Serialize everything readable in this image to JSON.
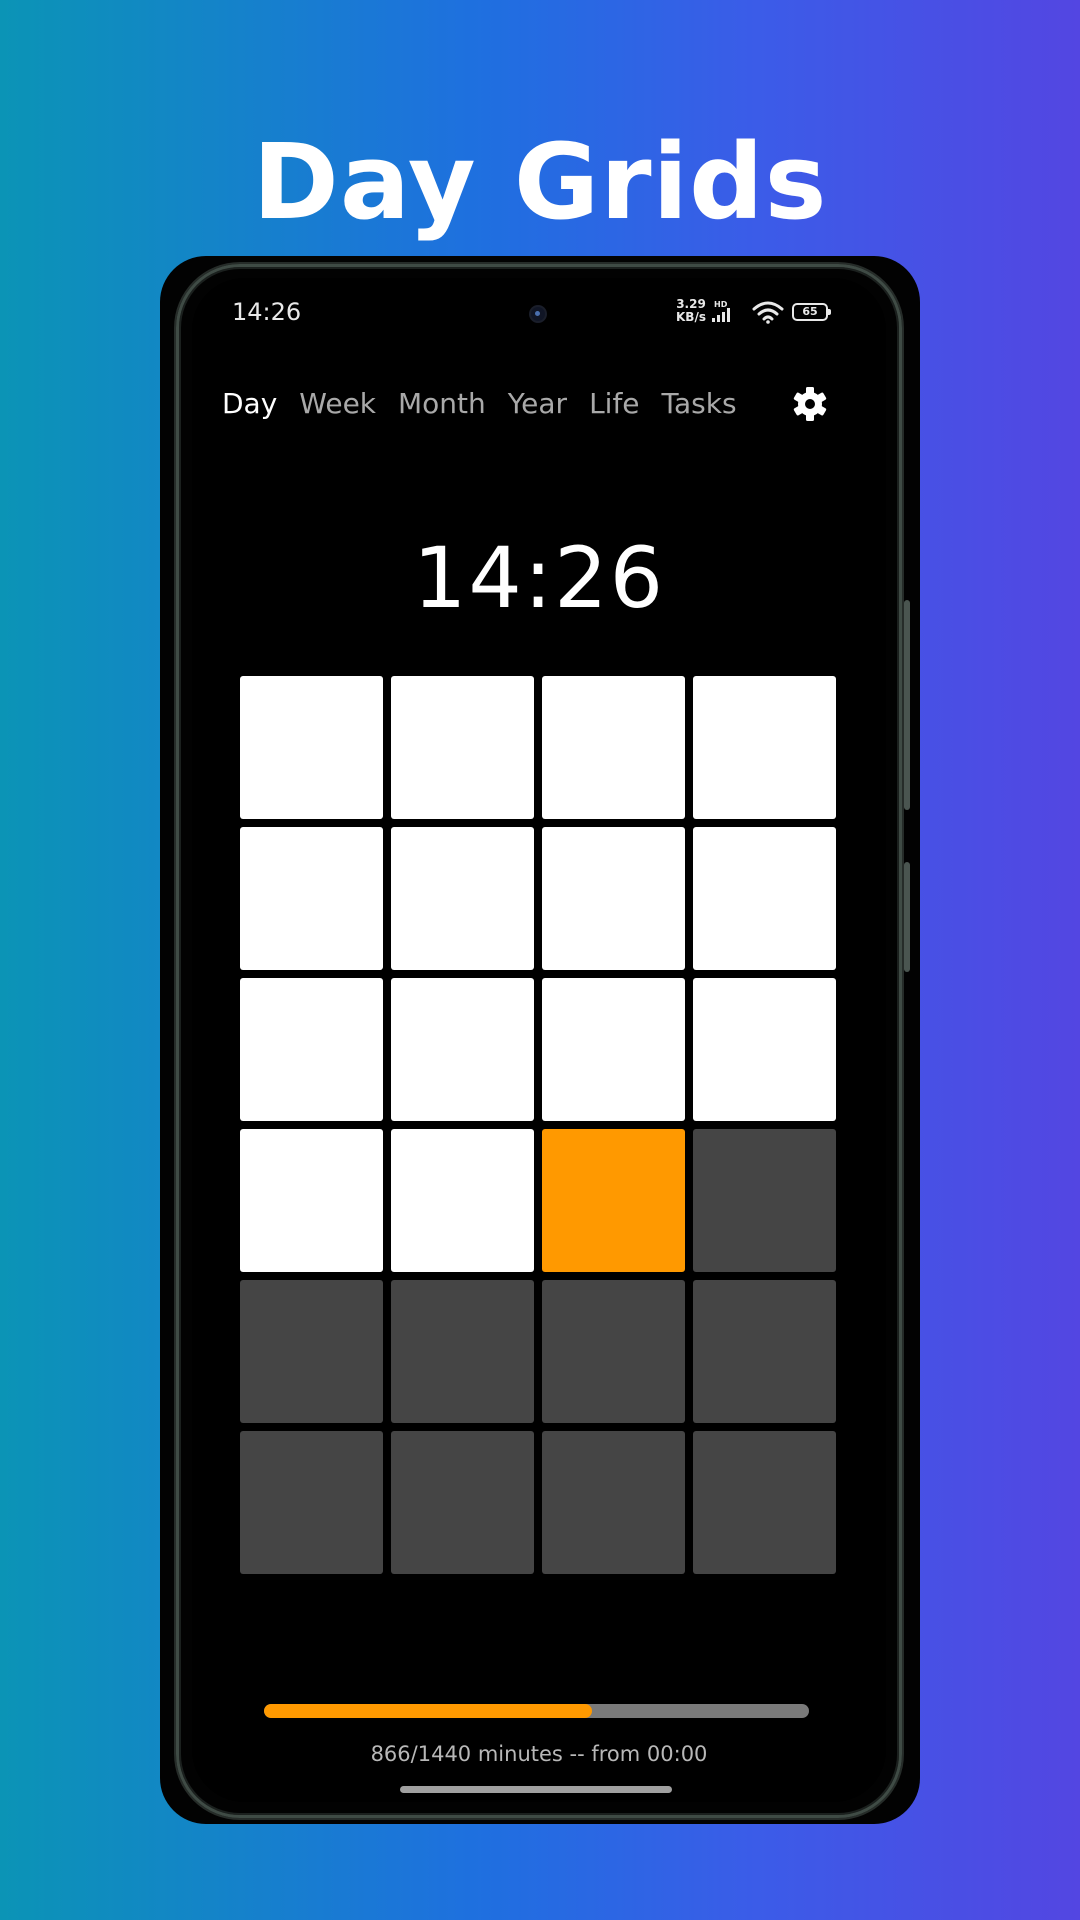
{
  "headline": "Day Grids",
  "status_bar": {
    "time": "14:26",
    "net_speed_value": "3.29",
    "net_speed_unit": "KB/s",
    "hd_label": "HD",
    "battery": "65"
  },
  "tabs": [
    {
      "label": "Day",
      "active": true
    },
    {
      "label": "Week",
      "active": false
    },
    {
      "label": "Month",
      "active": false
    },
    {
      "label": "Year",
      "active": false
    },
    {
      "label": "Life",
      "active": false
    },
    {
      "label": "Tasks",
      "active": false
    }
  ],
  "settings_icon": "gear-icon",
  "clock": "14:26",
  "grid": {
    "columns": 4,
    "rows": 6,
    "completed_cells": 14,
    "current_cell_index": 14,
    "total_cells": 24
  },
  "colors": {
    "done": "#ffffff",
    "current": "#ff9900",
    "future": "#454545",
    "progress_fill": "#ff9900",
    "progress_track": "#7a7a7a"
  },
  "progress": {
    "fraction": 0.601,
    "label": "866/1440 minutes -- from 00:00"
  }
}
